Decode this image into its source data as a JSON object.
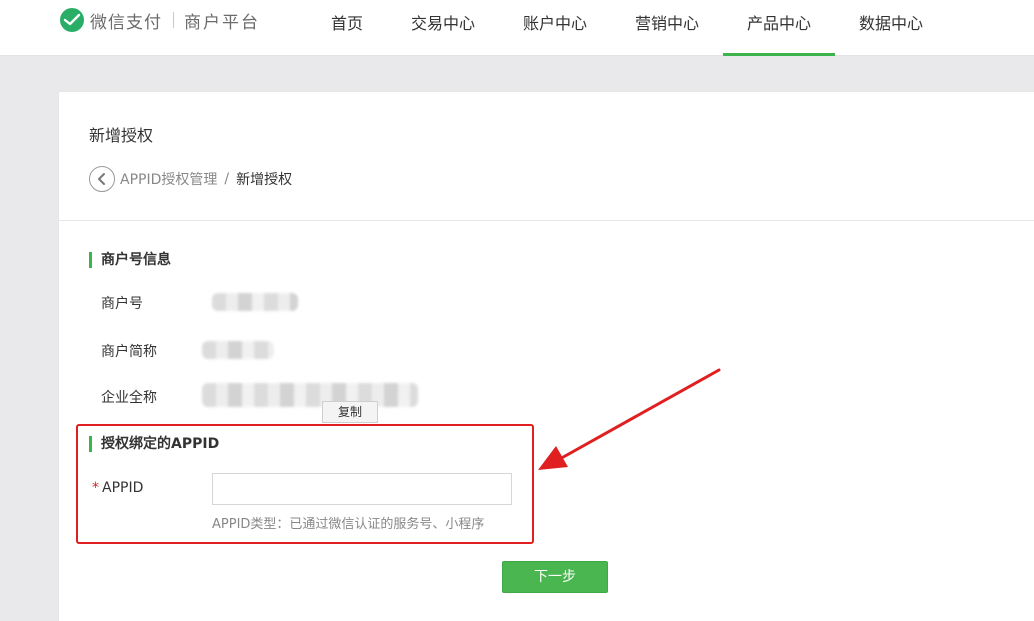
{
  "header": {
    "brand_name": "微信支付",
    "brand_sub": "商户平台",
    "nav": [
      {
        "label": "首页",
        "active": false
      },
      {
        "label": "交易中心",
        "active": false
      },
      {
        "label": "账户中心",
        "active": false
      },
      {
        "label": "营销中心",
        "active": false
      },
      {
        "label": "产品中心",
        "active": true
      },
      {
        "label": "数据中心",
        "active": false
      }
    ]
  },
  "page": {
    "title": "新增授权",
    "breadcrumb": {
      "parent": "APPID授权管理",
      "separator": "/",
      "current": "新增授权"
    }
  },
  "merchant_section": {
    "title": "商户号信息",
    "fields": [
      {
        "label": "商户号"
      },
      {
        "label": "商户简称"
      },
      {
        "label": "企业全称"
      }
    ],
    "copy_label": "复制"
  },
  "appid_section": {
    "title": "授权绑定的APPID",
    "required_mark": "*",
    "field_label": "APPID",
    "input_value": "",
    "hint": "APPID类型：已通过微信认证的服务号、小程序"
  },
  "actions": {
    "next_label": "下一步"
  },
  "colors": {
    "accent": "#3cb34b",
    "button": "#4ab64f",
    "annotation": "#e02020"
  }
}
